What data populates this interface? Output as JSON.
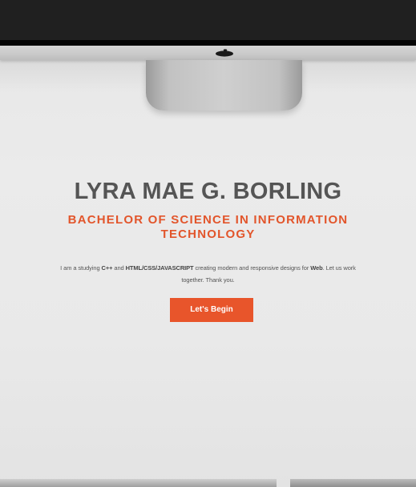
{
  "hero": {
    "name": "LYRA MAE G. BORLING",
    "degree": "BACHELOR OF SCIENCE IN INFORMATION TECHNOLOGY",
    "intro": [
      {
        "text": "I am a studying ",
        "bold": false
      },
      {
        "text": "C++",
        "bold": true
      },
      {
        "text": " and ",
        "bold": false
      },
      {
        "text": "HTML/CSS/JAVASCRIPT",
        "bold": true
      },
      {
        "text": " creating modern and responsive designs for ",
        "bold": false
      },
      {
        "text": "Web",
        "bold": true
      },
      {
        "text": ". Let us work together. Thank you.",
        "bold": false
      }
    ],
    "cta_label": "Let's Begin"
  },
  "decoration": {
    "logo_icon": "apple-logo-icon",
    "accent_color": "#e8552b",
    "name_color": "#555555"
  }
}
